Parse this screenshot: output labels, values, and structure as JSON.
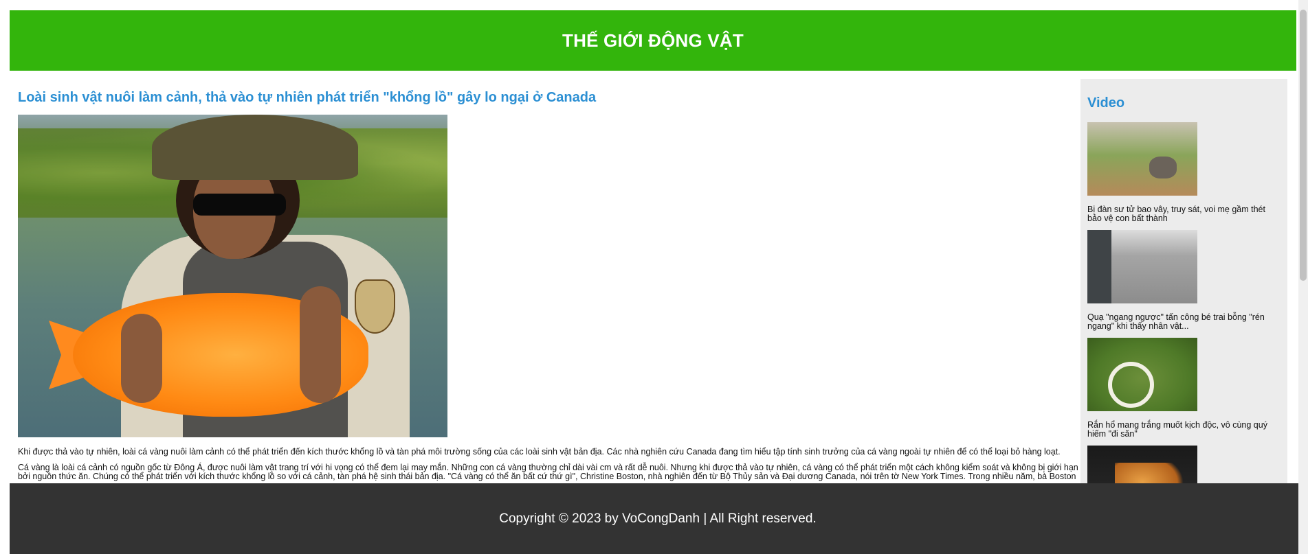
{
  "header": {
    "title": "THẾ GIỚI ĐỘNG VẬT"
  },
  "article": {
    "title": "Loài sinh vật nuôi làm cảnh, thả vào tự nhiên phát triển \"khổng lồ\" gây lo ngại ở Canada",
    "paragraphs": [
      "Khi được thả vào tự nhiên, loài cá vàng nuôi làm cảnh có thể phát triển đến kích thước khổng lồ và tàn phá môi trường sống của các loài sinh vật bản địa. Các nhà nghiên cứu Canada đang tìm hiểu tập tính sinh trưởng của cá vàng ngoài tự nhiên để có thể loại bỏ hàng loạt.",
      "Cá vàng là loài cá cảnh có nguồn gốc từ Đông Á, được nuôi làm vật trang trí với hi vọng có thể đem lại may mắn. Những con cá vàng thường chỉ dài vài cm và rất dễ nuôi. Nhưng khi được thả vào tự nhiên, cá vàng có thể phát triển một cách không kiểm soát và không bị giới hạn bởi nguồn thức ăn. Chúng có thể phát triển với kích thước khổng lồ so với cá cảnh, tàn phá hệ sinh thái bản địa. \"Cá vàng có thể ăn bất cứ thứ gì\", Christine Boston, nhà nghiên đến từ Bộ Thủy sản và Đại dương Canada, nói trên tờ New York Times. Trong nhiều năm, bà Boston"
    ]
  },
  "sidebar": {
    "title": "Video",
    "videos": [
      {
        "caption": "Bị đàn sư tử bao vây, truy sát, voi mẹ gầm thét bảo vệ con bất thành"
      },
      {
        "caption": "Quạ \"ngang ngược\" tấn công bé trai bỗng \"rén ngang\" khi thấy nhân vật..."
      },
      {
        "caption": "Rắn hổ mang trắng muốt kịch độc, vô cùng quý hiếm \"đi săn\""
      },
      {
        "caption": ""
      }
    ]
  },
  "footer": {
    "text": "Copyright © 2023 by VoCongDanh | All Right reserved."
  },
  "colors": {
    "header_bg": "#33b50c",
    "accent_blue": "#2b8fd3",
    "footer_bg": "#333333",
    "sidebar_bg": "#ececec"
  }
}
